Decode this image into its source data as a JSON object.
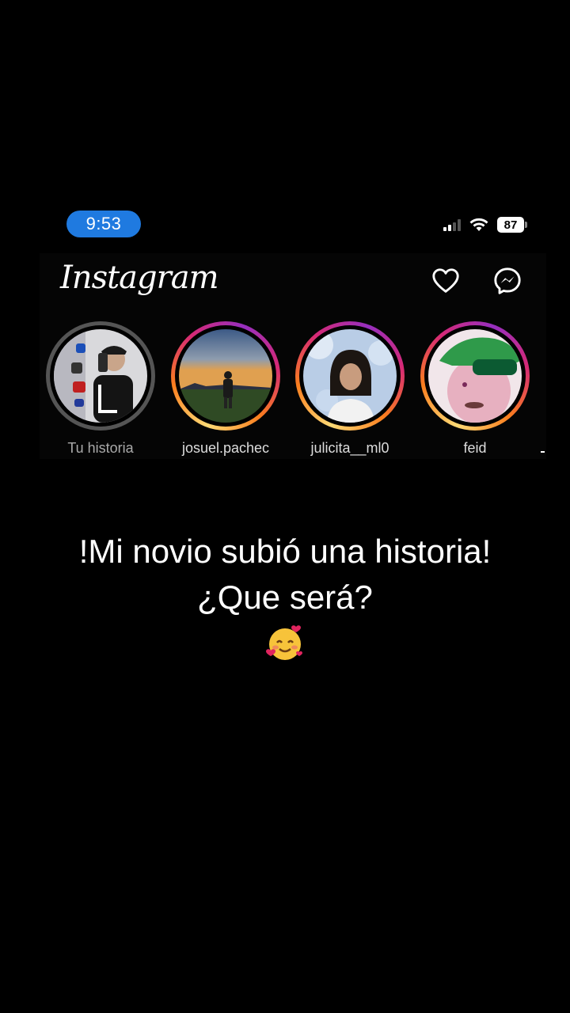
{
  "status_bar": {
    "time": "9:53",
    "battery": "87"
  },
  "app": {
    "name": "Instagram"
  },
  "header": {
    "icons": [
      "heart-icon",
      "messenger-icon"
    ]
  },
  "stories": [
    {
      "label": "Tu historia",
      "seen": true
    },
    {
      "label": "josuel.pachec",
      "seen": false
    },
    {
      "label": "julicita__ml0",
      "seen": false
    },
    {
      "label": "feid",
      "seen": false
    }
  ],
  "caption": {
    "line1": "!Mi novio subió una historia!",
    "line2": "¿Que será?",
    "emoji": "smiling-face-with-hearts"
  }
}
